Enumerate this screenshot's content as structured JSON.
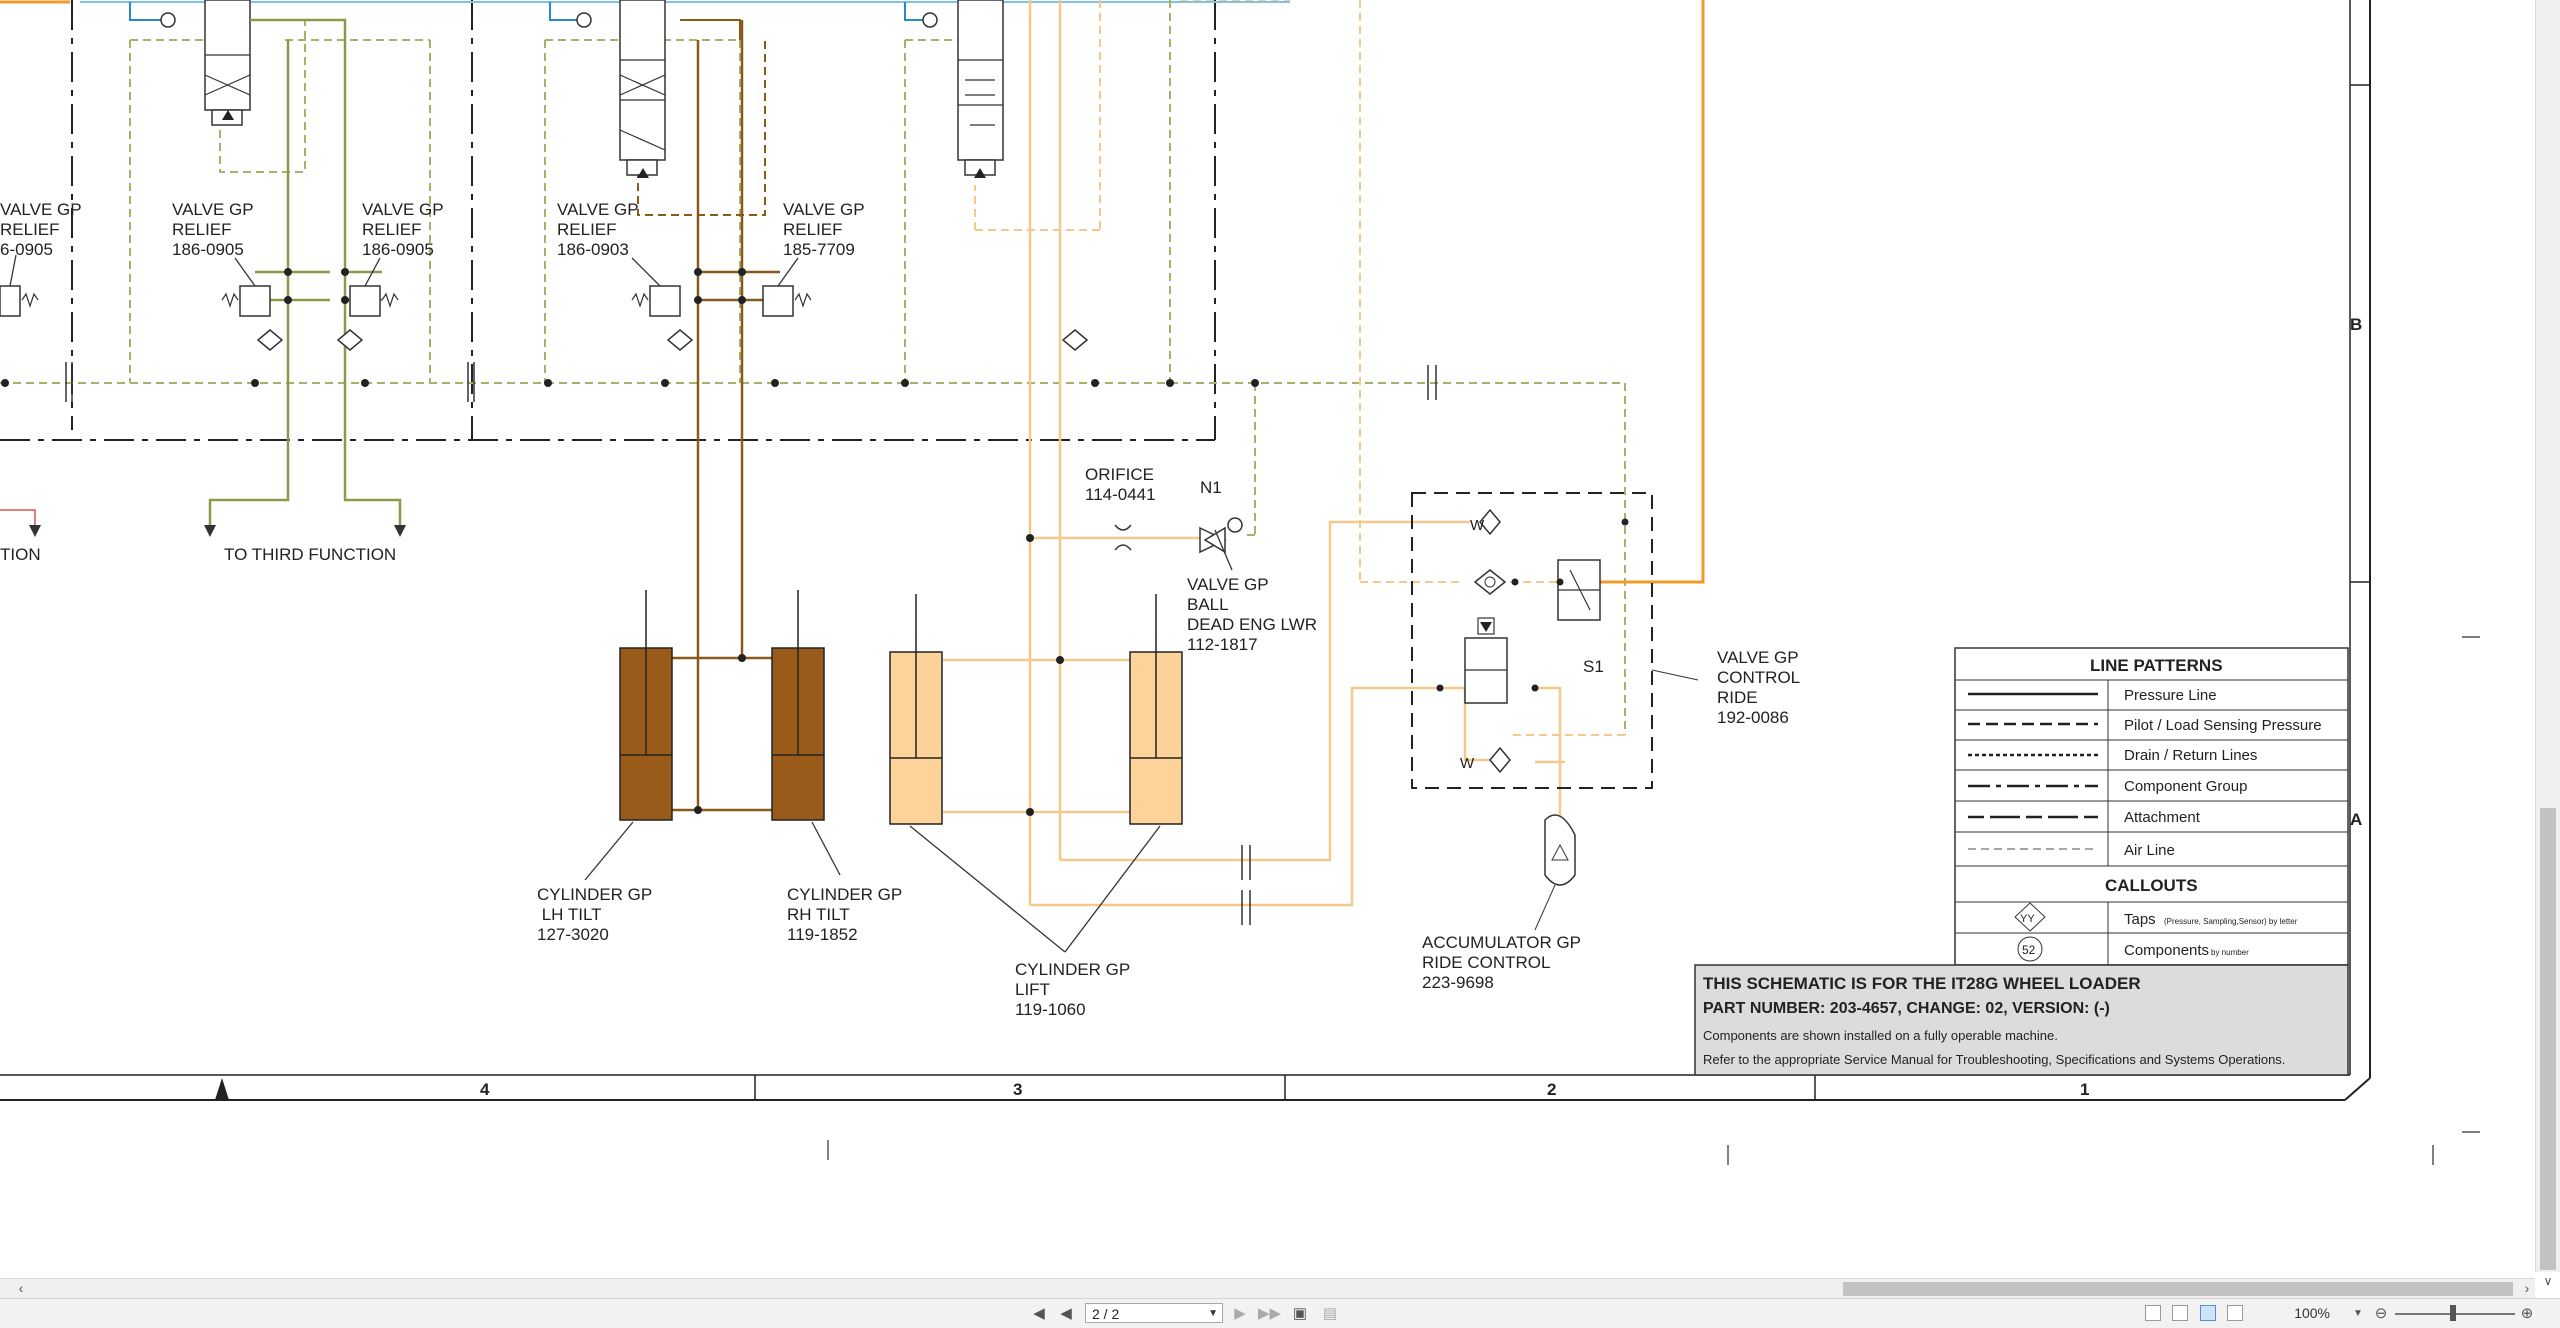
{
  "schematic": {
    "components": {
      "valve_relief_a": [
        "VALVE GP",
        "RELIEF",
        "186-0905"
      ],
      "valve_relief_b": [
        "VALVE GP",
        "RELIEF",
        "186-0905"
      ],
      "valve_relief_c": [
        "VALVE GP",
        "RELIEF",
        "186-0903"
      ],
      "valve_relief_d": [
        "VALVE GP",
        "RELIEF",
        "185-7709"
      ],
      "valve_relief_left_cut": [
        "VALVE GP",
        "RELIEF",
        "6-0905"
      ],
      "to_third_function": "TO THIRD FUNCTION",
      "to_left_cut": "TION",
      "orifice": [
        "ORIFICE",
        "114-0441"
      ],
      "n1": "N1",
      "valve_ball": [
        "VALVE GP",
        "BALL",
        "DEAD ENG LWR",
        "112-1817"
      ],
      "valve_ride": [
        "VALVE GP",
        "CONTROL",
        "RIDE",
        "192-0086"
      ],
      "s1": "S1",
      "cyl_lh_tilt": [
        "CYLINDER GP",
        " LH TILT",
        "127-3020"
      ],
      "cyl_rh_tilt": [
        "CYLINDER GP",
        "RH TILT",
        "119-1852"
      ],
      "cyl_lift": [
        "CYLINDER GP",
        "LIFT",
        "119-1060"
      ],
      "accumulator": [
        "ACCUMULATOR GP",
        "RIDE CONTROL",
        "223-9698"
      ]
    },
    "zones": {
      "b": "B",
      "a": "A"
    },
    "columns": [
      "4",
      "3",
      "2",
      "1"
    ],
    "legend": {
      "title": "LINE PATTERNS",
      "items": [
        "Pressure Line",
        "Pilot / Load Sensing Pressure",
        "Drain / Return Lines",
        "Component Group",
        "Attachment",
        "Air Line"
      ],
      "callouts_title": "CALLOUTS",
      "tap_symbol": "YY",
      "tap_label": "Taps",
      "tap_note": "(Pressure, Sampling,Sensor) by letter",
      "component_symbol": "52",
      "component_label": "Components",
      "component_note": "by number"
    },
    "title_block": {
      "line1": "THIS SCHEMATIC IS FOR THE IT28G WHEEL LOADER",
      "line2": "PART NUMBER: 203-4657, CHANGE: 02, VERSION: (-)",
      "line3": "Components are shown installed on a fully operable machine.",
      "line4": "Refer to the appropriate Service Manual for Troubleshooting, Specifications and Systems Operations."
    },
    "colors": {
      "pilot_green": "#8a9a4a",
      "tilt_brown": "#8b5a1b",
      "lift_orange": "#f5c98a",
      "supply_orange": "#f39a2e",
      "blue": "#2a8ac8",
      "tilt_fill": "#9a5b1a",
      "lift_fill": "#fdd39a"
    }
  },
  "viewer": {
    "page_indicator": "2 / 2",
    "zoom": "100%",
    "icons": [
      "first-page-icon",
      "prev-page-icon",
      "next-page-icon",
      "last-page-icon",
      "fit-page-icon",
      "fit-width-icon",
      "single-page-icon",
      "continuous-icon",
      "two-page-icon",
      "book-icon",
      "zoom-out-icon",
      "zoom-in-icon"
    ]
  }
}
